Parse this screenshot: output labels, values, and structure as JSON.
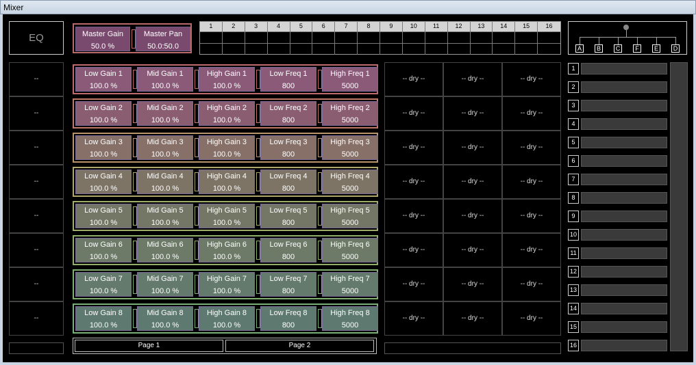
{
  "window": {
    "title": "Mixer"
  },
  "eq_button": {
    "label": "EQ"
  },
  "master": {
    "gain": {
      "label": "Master Gain",
      "value": "50.0 %"
    },
    "pan": {
      "label": "Master Pan",
      "value": "50.0:50.0"
    }
  },
  "channel_grid": {
    "headers": [
      "1",
      "2",
      "3",
      "4",
      "5",
      "6",
      "7",
      "8",
      "9",
      "10",
      "11",
      "12",
      "13",
      "14",
      "15",
      "16"
    ]
  },
  "routing_tree": {
    "nodes": [
      "A",
      "B",
      "C",
      "F",
      "E",
      "D"
    ]
  },
  "left_column": {
    "cells": [
      "--",
      "--",
      "--",
      "--",
      "--",
      "--",
      "--",
      "--"
    ]
  },
  "eq_bands": [
    {
      "low_gain": "Low Gain 1",
      "mid_gain": "Mid Gain 1",
      "high_gain": "High Gain 1",
      "low_freq": "Low Freq 1",
      "high_freq": "High Freq 1",
      "lg_val": "100.0 %",
      "mg_val": "100.0 %",
      "hg_val": "100.0 %",
      "lf_val": "800",
      "hf_val": "5000",
      "color": "#8a5a78",
      "border": "#c06a6a"
    },
    {
      "low_gain": "Low Gain 2",
      "mid_gain": "Mid Gain 2",
      "high_gain": "High Gain 2",
      "low_freq": "Low Freq 2",
      "high_freq": "High Freq 2",
      "lg_val": "100.0 %",
      "mg_val": "100.0 %",
      "hg_val": "100.0 %",
      "lf_val": "800",
      "hf_val": "5000",
      "color": "#8a5d70",
      "border": "#c07a6a"
    },
    {
      "low_gain": "Low Gain 3",
      "mid_gain": "Mid Gain 3",
      "high_gain": "High Gain 3",
      "low_freq": "Low Freq 3",
      "high_freq": "High Freq 3",
      "lg_val": "100.0 %",
      "mg_val": "100.0 %",
      "hg_val": "100.0 %",
      "lf_val": "800",
      "hf_val": "5000",
      "color": "#867068",
      "border": "#b8956a"
    },
    {
      "low_gain": "Low Gain 4",
      "mid_gain": "Mid Gain 4",
      "high_gain": "High Gain 4",
      "low_freq": "Low Freq 4",
      "high_freq": "High Freq 4",
      "lg_val": "100.0 %",
      "mg_val": "100.0 %",
      "hg_val": "100.0 %",
      "lf_val": "800",
      "hf_val": "5000",
      "color": "#7e7466",
      "border": "#b0a86a"
    },
    {
      "low_gain": "Low Gain 5",
      "mid_gain": "Mid Gain 5",
      "high_gain": "High Gain 5",
      "low_freq": "Low Freq 5",
      "high_freq": "High Freq 5",
      "lg_val": "100.0 %",
      "mg_val": "100.0 %",
      "hg_val": "100.0 %",
      "lf_val": "800",
      "hf_val": "5000",
      "color": "#757766",
      "border": "#a0b06a"
    },
    {
      "low_gain": "Low Gain 6",
      "mid_gain": "Mid Gain 6",
      "high_gain": "High Gain 6",
      "low_freq": "Low Freq 6",
      "high_freq": "High Freq 6",
      "lg_val": "100.0 %",
      "mg_val": "100.0 %",
      "hg_val": "100.0 %",
      "lf_val": "800",
      "hf_val": "5000",
      "color": "#6d7a68",
      "border": "#90b06a"
    },
    {
      "low_gain": "Low Gain 7",
      "mid_gain": "Mid Gain 7",
      "high_gain": "High Gain 7",
      "low_freq": "Low Freq 7",
      "high_freq": "High Freq 7",
      "lg_val": "100.0 %",
      "mg_val": "100.0 %",
      "hg_val": "100.0 %",
      "lf_val": "800",
      "hf_val": "5000",
      "color": "#647a6c",
      "border": "#80b070"
    },
    {
      "low_gain": "Low Gain 8",
      "mid_gain": "Mid Gain 8",
      "high_gain": "High Gain 8",
      "low_freq": "Low Freq 8",
      "high_freq": "High Freq 8",
      "lg_val": "100.0 %",
      "mg_val": "100.0 %",
      "hg_val": "100.0 %",
      "lf_val": "800",
      "hf_val": "5000",
      "color": "#5e7a70",
      "border": "#78b078"
    }
  ],
  "dry_label": "-- dry --",
  "numbered_list": [
    "1",
    "2",
    "3",
    "4",
    "5",
    "6",
    "7",
    "8",
    "9",
    "10",
    "11",
    "12",
    "13",
    "14",
    "15",
    "16"
  ],
  "pages": {
    "page1": "Page 1",
    "page2": "Page 2"
  }
}
